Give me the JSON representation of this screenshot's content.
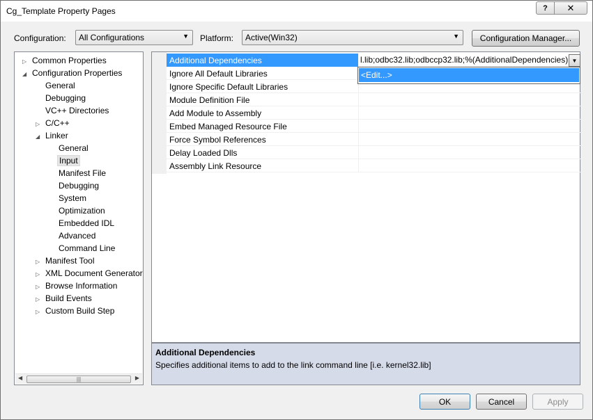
{
  "window": {
    "title": "Cg_Template Property Pages",
    "help_label": "?",
    "close_label": "✕"
  },
  "config": {
    "label": "Configuration:",
    "value": "All Configurations"
  },
  "platform": {
    "label": "Platform:",
    "value": "Active(Win32)"
  },
  "config_manager_label": "Configuration Manager...",
  "tree": {
    "items": [
      {
        "label": "Common Properties",
        "expander": "▷"
      },
      {
        "label": "Configuration Properties",
        "expander": "◢"
      },
      {
        "label": "General",
        "expander": ""
      },
      {
        "label": "Debugging",
        "expander": ""
      },
      {
        "label": "VC++ Directories",
        "expander": ""
      },
      {
        "label": "C/C++",
        "expander": "▷"
      },
      {
        "label": "Linker",
        "expander": "◢"
      },
      {
        "label": "General",
        "expander": ""
      },
      {
        "label": "Input",
        "expander": ""
      },
      {
        "label": "Manifest File",
        "expander": ""
      },
      {
        "label": "Debugging",
        "expander": ""
      },
      {
        "label": "System",
        "expander": ""
      },
      {
        "label": "Optimization",
        "expander": ""
      },
      {
        "label": "Embedded IDL",
        "expander": ""
      },
      {
        "label": "Advanced",
        "expander": ""
      },
      {
        "label": "Command Line",
        "expander": ""
      },
      {
        "label": "Manifest Tool",
        "expander": "▷"
      },
      {
        "label": "XML Document Generator",
        "expander": "▷"
      },
      {
        "label": "Browse Information",
        "expander": "▷"
      },
      {
        "label": "Build Events",
        "expander": "▷"
      },
      {
        "label": "Custom Build Step",
        "expander": "▷"
      }
    ],
    "scroll_left": "◀",
    "scroll_right": "▶",
    "scroll_grip": "|||"
  },
  "grid": {
    "rows": [
      {
        "name": "Additional Dependencies",
        "value": ""
      },
      {
        "name": "Ignore All Default Libraries",
        "value": ""
      },
      {
        "name": "Ignore Specific Default Libraries",
        "value": ""
      },
      {
        "name": "Module Definition File",
        "value": ""
      },
      {
        "name": "Add Module to Assembly",
        "value": ""
      },
      {
        "name": "Embed Managed Resource File",
        "value": ""
      },
      {
        "name": "Force Symbol References",
        "value": ""
      },
      {
        "name": "Delay Loaded Dlls",
        "value": ""
      },
      {
        "name": "Assembly Link Resource",
        "value": ""
      }
    ],
    "edit_value": "l.lib;odbc32.lib;odbccp32.lib;%(AdditionalDependencies)",
    "dropdown_arrow": "▼",
    "dropdown_option": "<Edit...>"
  },
  "description": {
    "title": "Additional Dependencies",
    "text": "Specifies additional items to add to the link command line [i.e. kernel32.lib]"
  },
  "buttons": {
    "ok": "OK",
    "cancel": "Cancel",
    "apply": "Apply"
  },
  "combo_arrow": "▼"
}
